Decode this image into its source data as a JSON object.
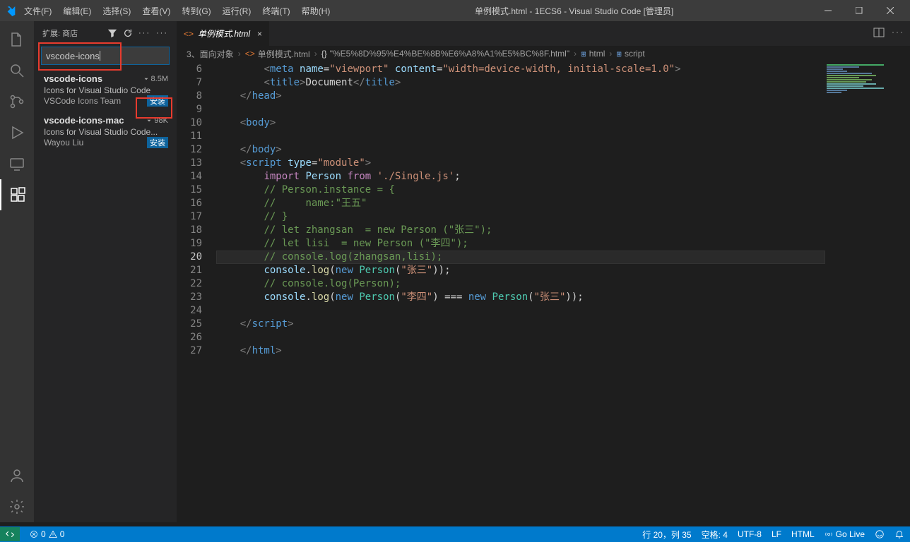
{
  "titlebar": {
    "menus": [
      "文件(F)",
      "编辑(E)",
      "选择(S)",
      "查看(V)",
      "转到(G)",
      "运行(R)",
      "终端(T)",
      "帮助(H)"
    ],
    "title": "单例模式.html - 1ECS6 - Visual Studio Code [管理员]"
  },
  "sidebar": {
    "title": "扩展: 商店",
    "search_value": "vscode-icons",
    "extensions": [
      {
        "name": "vscode-icons",
        "desc": "Icons for Visual Studio Code",
        "author": "VSCode Icons Team",
        "dl": "8.5M",
        "btn": "安装"
      },
      {
        "name": "vscode-icons-mac",
        "desc": "Icons for Visual Studio Code...",
        "author": "Wayou Liu",
        "dl": "98K",
        "btn": "安装"
      }
    ]
  },
  "tab": {
    "label": "单例模式.html"
  },
  "breadcrumb": {
    "parts": [
      "3、面向对象",
      "单例模式.html",
      "\"%E5%8D%95%E4%BE%8B%E6%A8%A1%E5%BC%8F.html\"",
      "html",
      "script"
    ]
  },
  "lines": {
    "start": 6,
    "end": 27,
    "current": 20
  },
  "code": [
    {
      "n": 6,
      "html": "        <span class='c-pun'>&lt;</span><span class='c-tag'>meta</span> <span class='c-attr'>name</span><span class='c-txt'>=</span><span class='c-str'>\"viewport\"</span> <span class='c-attr'>content</span><span class='c-txt'>=</span><span class='c-str'>\"width=device-width, initial-scale=1.0\"</span><span class='c-pun'>&gt;</span>"
    },
    {
      "n": 7,
      "html": "        <span class='c-pun'>&lt;</span><span class='c-tag'>title</span><span class='c-pun'>&gt;</span><span class='c-txt'>Document</span><span class='c-pun'>&lt;/</span><span class='c-tag'>title</span><span class='c-pun'>&gt;</span>"
    },
    {
      "n": 8,
      "html": "    <span class='c-pun'>&lt;/</span><span class='c-tag'>head</span><span class='c-pun'>&gt;</span>"
    },
    {
      "n": 9,
      "html": ""
    },
    {
      "n": 10,
      "html": "    <span class='c-pun'>&lt;</span><span class='c-tag'>body</span><span class='c-pun'>&gt;</span>"
    },
    {
      "n": 11,
      "html": ""
    },
    {
      "n": 12,
      "html": "    <span class='c-pun'>&lt;/</span><span class='c-tag'>body</span><span class='c-pun'>&gt;</span>"
    },
    {
      "n": 13,
      "html": "    <span class='c-pun'>&lt;</span><span class='c-tag'>script</span> <span class='c-attr'>type</span><span class='c-txt'>=</span><span class='c-str'>\"module\"</span><span class='c-pun'>&gt;</span>"
    },
    {
      "n": 14,
      "html": "        <span class='c-key'>import</span> <span class='c-attr'>Person</span> <span class='c-key'>from</span> <span class='c-str'>'./Single.js'</span><span class='c-txt'>;</span>"
    },
    {
      "n": 15,
      "html": "        <span class='c-com'>// Person.instance = {</span>"
    },
    {
      "n": 16,
      "html": "        <span class='c-com'>//     name:\"王五\"</span>"
    },
    {
      "n": 17,
      "html": "        <span class='c-com'>// }</span>"
    },
    {
      "n": 18,
      "html": "        <span class='c-com'>// let zhangsan  = new Person (\"张三\");</span>"
    },
    {
      "n": 19,
      "html": "        <span class='c-com'>// let lisi  = new Person (\"李四\");</span>"
    },
    {
      "n": 20,
      "html": "        <span class='c-com'>// console.log(zhangsan,lisi);</span>"
    },
    {
      "n": 21,
      "html": "        <span class='c-attr'>console</span><span class='c-txt'>.</span><span class='c-fn'>log</span><span class='c-txt'>(</span><span class='c-tag'>new</span> <span class='c-cls'>Person</span><span class='c-txt'>(</span><span class='c-str'>\"张三\"</span><span class='c-txt'>));</span>"
    },
    {
      "n": 22,
      "html": "        <span class='c-com'>// console.log(Person);</span>"
    },
    {
      "n": 23,
      "html": "        <span class='c-attr'>console</span><span class='c-txt'>.</span><span class='c-fn'>log</span><span class='c-txt'>(</span><span class='c-tag'>new</span> <span class='c-cls'>Person</span><span class='c-txt'>(</span><span class='c-str'>\"李四\"</span><span class='c-txt'>) === </span><span class='c-tag'>new</span> <span class='c-cls'>Person</span><span class='c-txt'>(</span><span class='c-str'>\"张三\"</span><span class='c-txt'>));</span>"
    },
    {
      "n": 24,
      "html": ""
    },
    {
      "n": 25,
      "html": "    <span class='c-pun'>&lt;/</span><span class='c-tag'>script</span><span class='c-pun'>&gt;</span>"
    },
    {
      "n": 26,
      "html": ""
    },
    {
      "n": 27,
      "html": "    <span class='c-pun'>&lt;/</span><span class='c-tag'>html</span><span class='c-pun'>&gt;</span>"
    }
  ],
  "statusbar": {
    "errors": "0",
    "warnings": "0",
    "lncol": "行 20，列 35",
    "spaces": "空格: 4",
    "enc": "UTF-8",
    "eol": "LF",
    "lang": "HTML",
    "golive": "Go Live",
    "feedback": ""
  }
}
